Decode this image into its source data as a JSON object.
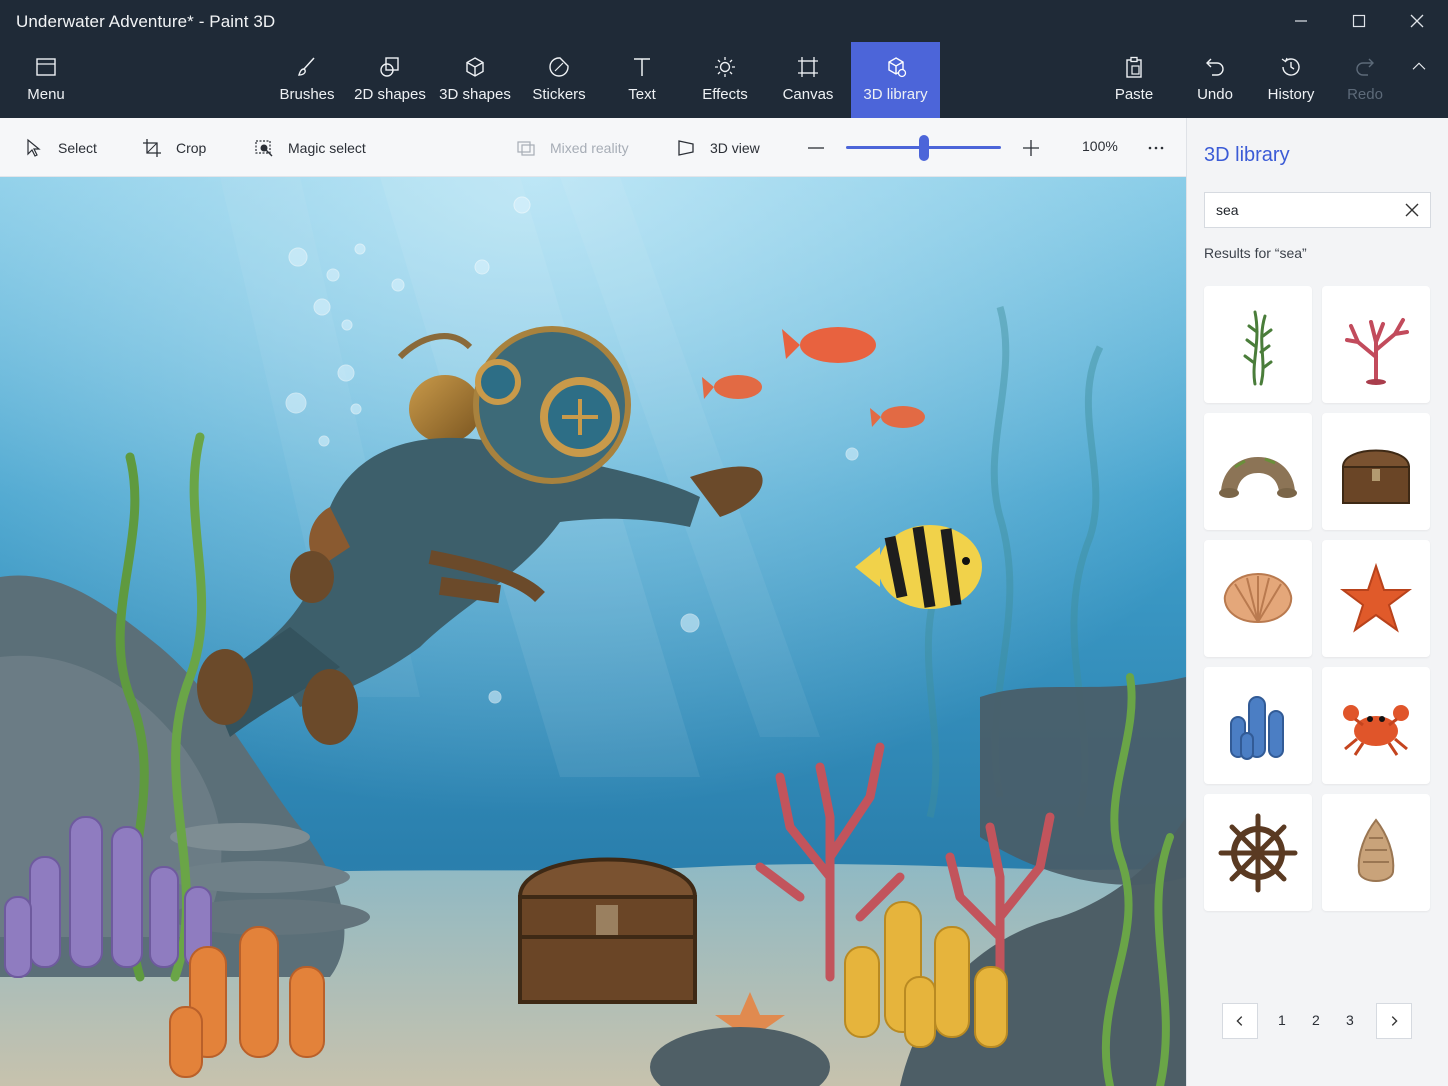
{
  "window": {
    "title": "Underwater Adventure* - Paint 3D",
    "controls": [
      "minimize-icon",
      "maximize-icon",
      "close-icon"
    ]
  },
  "ribbon": {
    "menu_label": "Menu",
    "tools": [
      {
        "label": "Brushes",
        "icon": "brush-icon"
      },
      {
        "label": "2D shapes",
        "icon": "2d-shapes-icon"
      },
      {
        "label": "3D shapes",
        "icon": "cube-icon"
      },
      {
        "label": "Stickers",
        "icon": "sticker-icon"
      },
      {
        "label": "Text",
        "icon": "text-icon"
      },
      {
        "label": "Effects",
        "icon": "sun-icon"
      },
      {
        "label": "Canvas",
        "icon": "canvas-icon"
      },
      {
        "label": "3D library",
        "icon": "3d-library-icon",
        "active": true
      }
    ],
    "actions": [
      {
        "label": "Paste",
        "icon": "paste-icon"
      },
      {
        "label": "Undo",
        "icon": "undo-icon"
      },
      {
        "label": "History",
        "icon": "history-icon"
      },
      {
        "label": "Redo",
        "icon": "redo-icon",
        "disabled": true
      }
    ],
    "accent": "#4c65d9"
  },
  "toolbar": {
    "select_label": "Select",
    "crop_label": "Crop",
    "magic_select_label": "Magic select",
    "mixed_reality_label": "Mixed reality",
    "view3d_label": "3D view",
    "zoom_value": "100%",
    "zoom_level": 0.5,
    "more_icon": "more-icon"
  },
  "panel": {
    "title": "3D library",
    "search": {
      "value": "sea",
      "placeholder": ""
    },
    "results_label": "Results for “sea”",
    "items": [
      {
        "name": "seaweed",
        "icon": "seaweed-icon"
      },
      {
        "name": "coral",
        "icon": "coral-icon"
      },
      {
        "name": "rock-arch",
        "icon": "rock-arch-icon"
      },
      {
        "name": "treasure-chest",
        "icon": "treasure-chest-icon"
      },
      {
        "name": "seashell",
        "icon": "seashell-icon"
      },
      {
        "name": "starfish",
        "icon": "starfish-icon"
      },
      {
        "name": "tube-sponge",
        "icon": "sponge-icon"
      },
      {
        "name": "crab",
        "icon": "crab-icon"
      },
      {
        "name": "ship-wheel",
        "icon": "ship-wheel-icon"
      },
      {
        "name": "conch-shell",
        "icon": "conch-icon"
      }
    ],
    "pagination": {
      "pages": [
        "1",
        "2",
        "3"
      ]
    }
  },
  "canvas": {
    "scene": "underwater-scene"
  }
}
